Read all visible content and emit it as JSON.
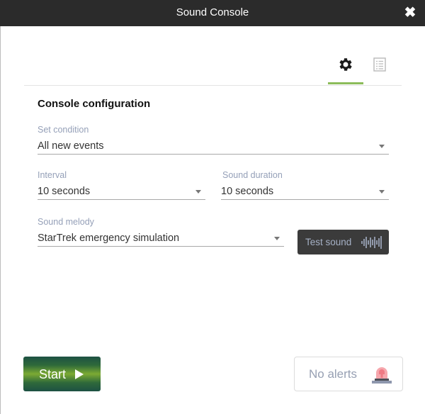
{
  "window": {
    "title": "Sound Console",
    "close_icon": "close-icon"
  },
  "tabs": [
    {
      "name": "settings",
      "icon": "gear-icon",
      "active": true
    },
    {
      "name": "log",
      "icon": "list-icon",
      "active": false
    }
  ],
  "section": {
    "title": "Console configuration"
  },
  "fields": {
    "condition": {
      "label": "Set condition",
      "value": "All new events"
    },
    "interval": {
      "label": "Interval",
      "value": "10 seconds"
    },
    "duration": {
      "label": "Sound duration",
      "value": "10 seconds"
    },
    "melody": {
      "label": "Sound melody",
      "value": "StarTrek emergency simulation"
    }
  },
  "buttons": {
    "test_sound": "Test sound",
    "start": "Start"
  },
  "status": {
    "alerts": "No alerts"
  },
  "colors": {
    "accent": "#8cbc5a",
    "titlebar": "#2b2b2b",
    "label": "#95a0b8"
  }
}
